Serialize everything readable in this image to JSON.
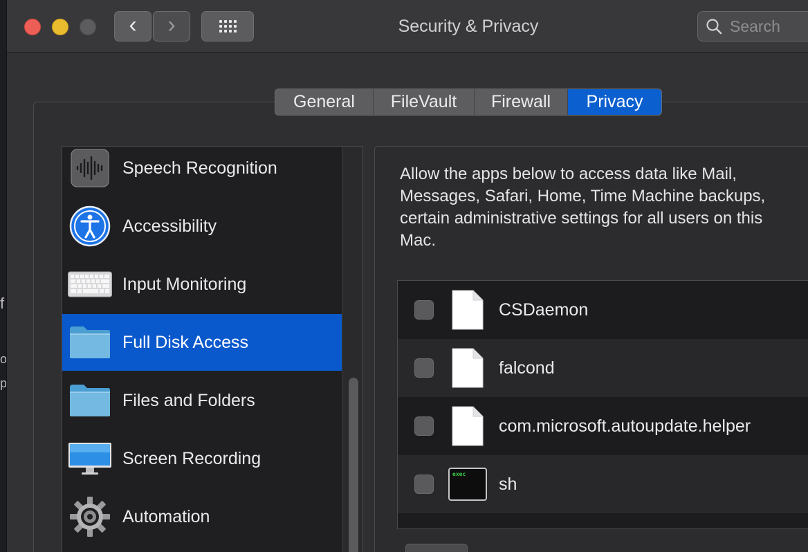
{
  "window": {
    "title": "Security & Privacy"
  },
  "toolbar": {
    "back_icon": "chevron-left-icon",
    "forward_icon": "chevron-right-icon",
    "show_all_icon": "grid-icon"
  },
  "search": {
    "placeholder": "Search",
    "icon": "search-icon"
  },
  "tabs": [
    {
      "label": "General",
      "selected": false
    },
    {
      "label": "FileVault",
      "selected": false
    },
    {
      "label": "Firewall",
      "selected": false
    },
    {
      "label": "Privacy",
      "selected": true
    }
  ],
  "sidebar": {
    "items": [
      {
        "label": "Speech Recognition",
        "icon": "waveform-icon",
        "selected": false
      },
      {
        "label": "Accessibility",
        "icon": "accessibility-icon",
        "selected": false
      },
      {
        "label": "Input Monitoring",
        "icon": "keyboard-icon",
        "selected": false
      },
      {
        "label": "Full Disk Access",
        "icon": "folder-icon",
        "selected": true
      },
      {
        "label": "Files and Folders",
        "icon": "folder-icon",
        "selected": false
      },
      {
        "label": "Screen Recording",
        "icon": "monitor-icon",
        "selected": false
      },
      {
        "label": "Automation",
        "icon": "gear-icon",
        "selected": false
      }
    ]
  },
  "panel": {
    "description": "Allow the apps below to access data like Mail,\nMessages, Safari, Home, Time Machine backups,\ncertain administrative settings for all users on this\nMac."
  },
  "apps": [
    {
      "label": "CSDaemon",
      "icon": "document-icon",
      "checked": false
    },
    {
      "label": "falcond",
      "icon": "document-icon",
      "checked": false
    },
    {
      "label": "com.microsoft.autoupdate.helper",
      "icon": "document-icon",
      "checked": false
    },
    {
      "label": "sh",
      "icon": "terminal-exec-icon",
      "icon_text": "exec",
      "checked": false
    }
  ],
  "colors": {
    "accent": "#0b5fce",
    "close": "#ed5f56",
    "minimize": "#e9bc2f",
    "zoom_inactive": "#5c5c5e"
  }
}
